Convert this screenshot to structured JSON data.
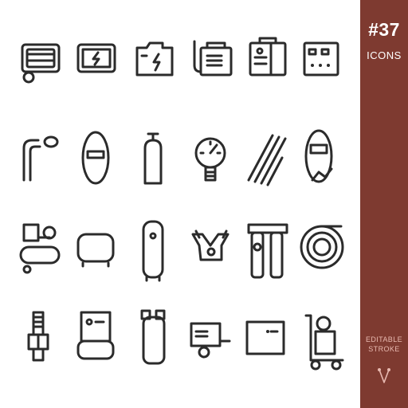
{
  "badge": {
    "count": "#37",
    "label": "ICONS",
    "footer_line1": "EDITABLE",
    "footer_line2": "STROKE"
  },
  "colors": {
    "sidebar_background": "#7e3a30",
    "icon_stroke": "#2b2b2b",
    "footer_text": "#e8b9b0"
  },
  "icons": [
    "generator-icon",
    "battery-charger-icon",
    "jerrycan-battery-icon",
    "welding-machine-icon",
    "inverter-welder-icon",
    "control-panel-icon",
    "welding-torch-icon",
    "welding-mask-icon",
    "gas-cylinder-icon",
    "pressure-gauge-icon",
    "welding-rods-icon",
    "welder-helmet-icon",
    "air-compressor-icon",
    "horizontal-tank-icon",
    "vertical-tank-icon",
    "compressor-pump-icon",
    "air-filter-regulator-icon",
    "air-hose-reel-icon",
    "hose-fitting-icon",
    "tank-compressor-unit-icon",
    "vertical-air-compressor-icon",
    "trailer-generator-icon",
    "power-box-icon",
    "hand-truck-compressor-icon"
  ]
}
